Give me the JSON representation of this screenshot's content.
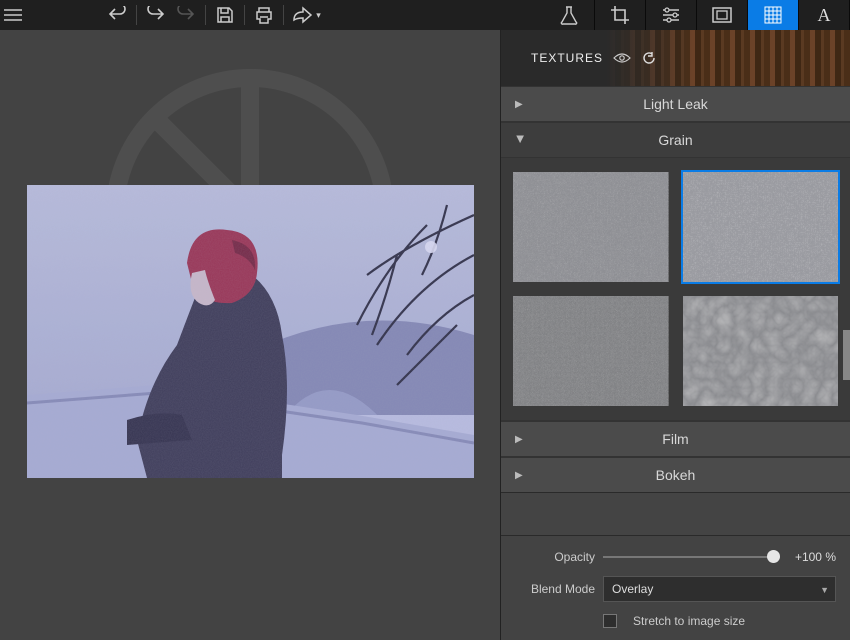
{
  "toolbar": {
    "undo": "undo",
    "redo_hist": "redo-history",
    "redo": "redo",
    "save": "save",
    "print": "print",
    "share": "share"
  },
  "tabs": [
    "lab",
    "crop",
    "adjust",
    "frame",
    "texture",
    "text"
  ],
  "panel": {
    "title": "TEXTURES"
  },
  "sections": {
    "light_leak": "Light Leak",
    "grain": "Grain",
    "film": "Film",
    "bokeh": "Bokeh"
  },
  "grain_thumbs": [
    "grain-1",
    "grain-2",
    "grain-3",
    "grain-4"
  ],
  "selected_thumb": 1,
  "controls": {
    "opacity_label": "Opacity",
    "opacity_value": "+100 %",
    "blendmode_label": "Blend Mode",
    "blendmode_value": "Overlay",
    "stretch_label": "Stretch to image size",
    "stretch_checked": false
  }
}
